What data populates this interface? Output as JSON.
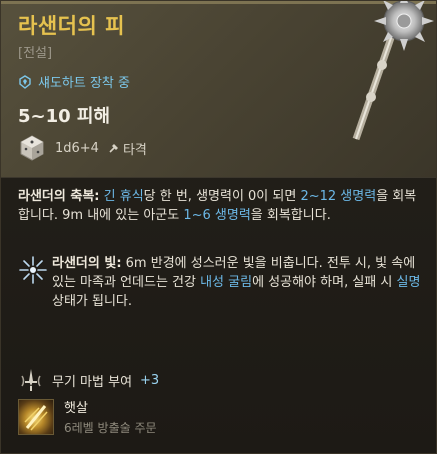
{
  "item": {
    "name": "라샌더의 피",
    "rarity": "[전설]",
    "equip_status": "섀도하트 장착 중",
    "damage": "5~10 피해",
    "dice_formula": "1d6+4",
    "damage_type": "타격"
  },
  "blessing": {
    "name": "라샌더의 축복:",
    "seg1": " ",
    "seg1_highlight": "긴 휴식",
    "seg2": "당 한 번, 생명력이 0이 되면 ",
    "seg2_highlight": "2~12 생명력",
    "seg3": "을 회복합니다. 9m 내에 있는 아군도 ",
    "seg3_highlight": "1~6 생명력",
    "seg4": "을 회복합니다."
  },
  "light": {
    "name": "라샌더의 빛:",
    "seg1": " 6m 반경에 성스러운 빛을 비춥니다. 전투 시, 빛 속에 있는 마족과 언데드는 건강 ",
    "seg1_highlight": "내성 굴림",
    "seg2": "에 성공해야 하며, 실패 시 ",
    "seg2_highlight": "실명",
    "seg3": " 상태가 됩니다."
  },
  "enchant": {
    "label": "무기 마법 부여",
    "value": "+3"
  },
  "spell": {
    "name": "햇살",
    "subtitle": "6레벨 방출술 주문"
  },
  "colors": {
    "title_gold": "#e6c24f",
    "highlight_blue": "#6cb8e6",
    "header_bg": "#4f4937",
    "body_bg": "#201d17"
  }
}
